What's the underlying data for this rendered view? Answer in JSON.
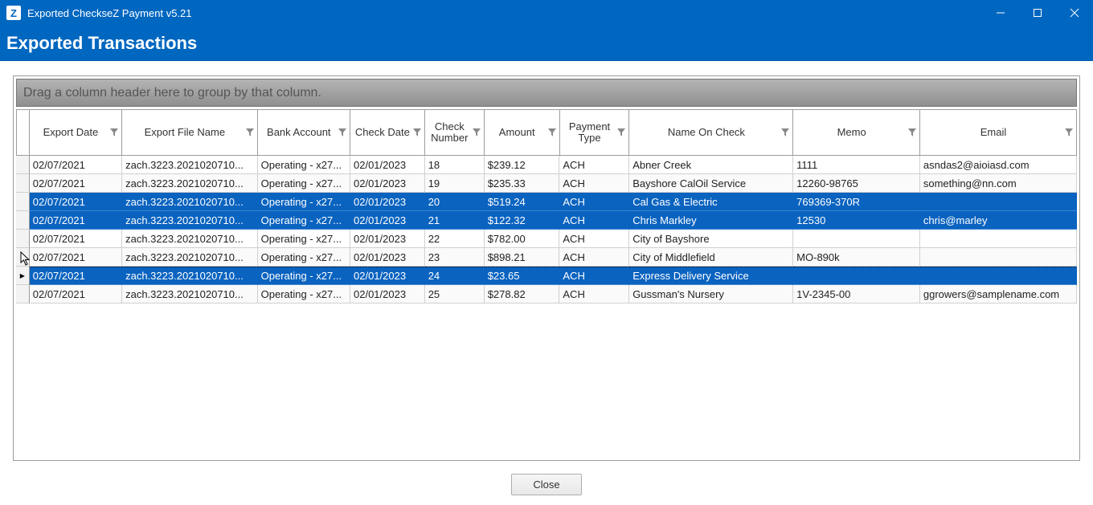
{
  "window": {
    "icon_letter": "Z",
    "title": "Exported CheckseZ Payment v5.21"
  },
  "page": {
    "header": "Exported Transactions"
  },
  "grid": {
    "group_panel_hint": "Drag a column header here to group by that column.",
    "columns": [
      "Export Date",
      "Export File Name",
      "Bank Account",
      "Check Date",
      "Check Number",
      "Amount",
      "Payment Type",
      "Name On Check",
      "Memo",
      "Email"
    ],
    "rows": [
      {
        "selected": false,
        "current": false,
        "export_date": "02/07/2021",
        "file": "zach.3223.2021020710...",
        "bank": "Operating - x27...",
        "check_date": "02/01/2023",
        "num": "18",
        "amount": "$239.12",
        "ptype": "ACH",
        "name": "Abner Creek",
        "memo": "1111",
        "email": "asndas2@aioiasd.com"
      },
      {
        "selected": false,
        "current": false,
        "export_date": "02/07/2021",
        "file": "zach.3223.2021020710...",
        "bank": "Operating - x27...",
        "check_date": "02/01/2023",
        "num": "19",
        "amount": "$235.33",
        "ptype": "ACH",
        "name": "Bayshore CalOil Service",
        "memo": "12260-98765",
        "email": "something@nn.com"
      },
      {
        "selected": true,
        "current": false,
        "export_date": "02/07/2021",
        "file": "zach.3223.2021020710...",
        "bank": "Operating - x27...",
        "check_date": "02/01/2023",
        "num": "20",
        "amount": "$519.24",
        "ptype": "ACH",
        "name": "Cal Gas & Electric",
        "memo": "769369-370R",
        "email": ""
      },
      {
        "selected": true,
        "current": false,
        "export_date": "02/07/2021",
        "file": "zach.3223.2021020710...",
        "bank": "Operating - x27...",
        "check_date": "02/01/2023",
        "num": "21",
        "amount": "$122.32",
        "ptype": "ACH",
        "name": "Chris Markley",
        "memo": "12530",
        "email": "chris@marley"
      },
      {
        "selected": false,
        "current": false,
        "export_date": "02/07/2021",
        "file": "zach.3223.2021020710...",
        "bank": "Operating - x27...",
        "check_date": "02/01/2023",
        "num": "22",
        "amount": "$782.00",
        "ptype": "ACH",
        "name": "City of Bayshore",
        "memo": "",
        "email": ""
      },
      {
        "selected": false,
        "current": false,
        "export_date": "02/07/2021",
        "file": "zach.3223.2021020710...",
        "bank": "Operating - x27...",
        "check_date": "02/01/2023",
        "num": "23",
        "amount": "$898.21",
        "ptype": "ACH",
        "name": "City of Middlefield",
        "memo": "MO-890k",
        "email": ""
      },
      {
        "selected": true,
        "current": true,
        "export_date": "02/07/2021",
        "file": "zach.3223.2021020710...",
        "bank": "Operating - x27...",
        "check_date": "02/01/2023",
        "num": "24",
        "amount": "$23.65",
        "ptype": "ACH",
        "name": "Express Delivery Service",
        "memo": "",
        "email": ""
      },
      {
        "selected": false,
        "current": false,
        "export_date": "02/07/2021",
        "file": "zach.3223.2021020710...",
        "bank": "Operating - x27...",
        "check_date": "02/01/2023",
        "num": "25",
        "amount": "$278.82",
        "ptype": "ACH",
        "name": "Gussman's Nursery",
        "memo": "1V-2345-00",
        "email": "ggrowers@samplename.com"
      }
    ]
  },
  "footer": {
    "close_label": "Close"
  }
}
